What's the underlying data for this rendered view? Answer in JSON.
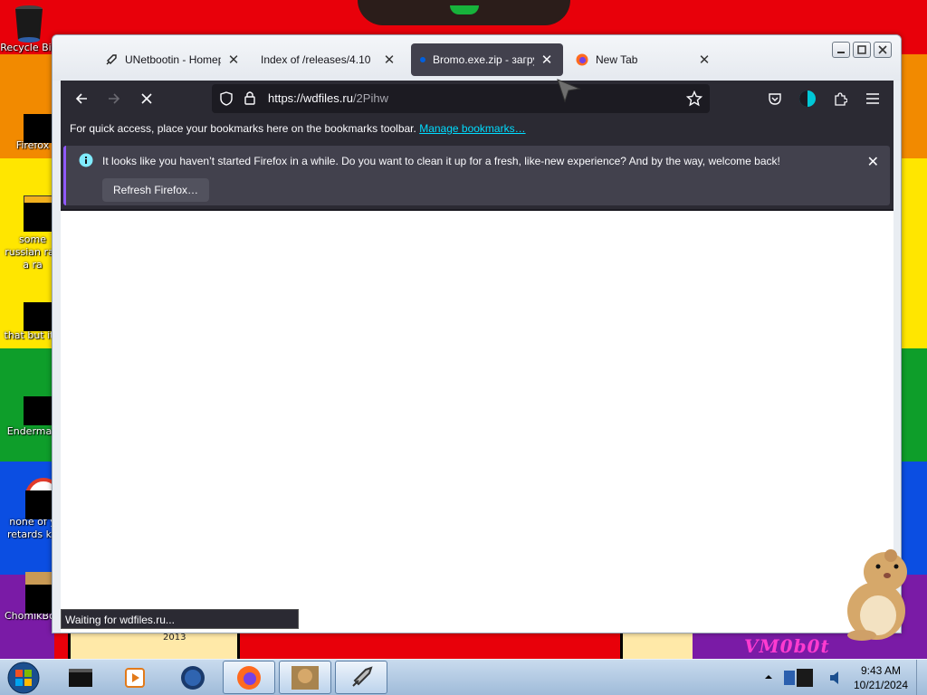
{
  "desktop": {
    "icons": [
      {
        "label": "Recycle Bin"
      },
      {
        "label": "Firefox"
      },
      {
        "label": "some russian ran a ra"
      },
      {
        "label": "that but it"
      },
      {
        "label": "Enderman"
      },
      {
        "label": "none of y retards kn"
      },
      {
        "label": "ChomikBox"
      }
    ],
    "wallpaper_year": "2013",
    "wallpaper_logo": "VM0b0t"
  },
  "browser": {
    "tabs": [
      {
        "title": "UNetbootin - Homep",
        "close": "✕"
      },
      {
        "title": "Index of /releases/4.10",
        "close": "✕"
      },
      {
        "title": "Bromo.exe.zip - загру",
        "close": "✕",
        "active": true
      },
      {
        "title": "New Tab",
        "close": "✕"
      }
    ],
    "url": {
      "main": "https://wdfiles.ru",
      "path": "/2Pihw"
    },
    "bookmarks_bar": {
      "text": "For quick access, place your bookmarks here on the bookmarks toolbar.",
      "link": "Manage bookmarks…"
    },
    "notification": {
      "message": "It looks like you haven’t started Firefox in a while. Do you want to clean it up for a fresh, like-new experience? And by the way, welcome back!",
      "button": "Refresh Firefox…",
      "close": "✕"
    },
    "status": "Waiting for wdfiles.ru..."
  },
  "taskbar": {
    "clock": {
      "time": "9:43 AM",
      "date": "10/21/2024"
    },
    "items": [
      "cmd",
      "media-player",
      "ie",
      "firefox",
      "chomikbox",
      "unetbootin"
    ]
  },
  "colors": {
    "accent": "#9059ff",
    "link": "#00ddff",
    "toolbar": "#2b2a33",
    "active_tab": "#42414d"
  }
}
